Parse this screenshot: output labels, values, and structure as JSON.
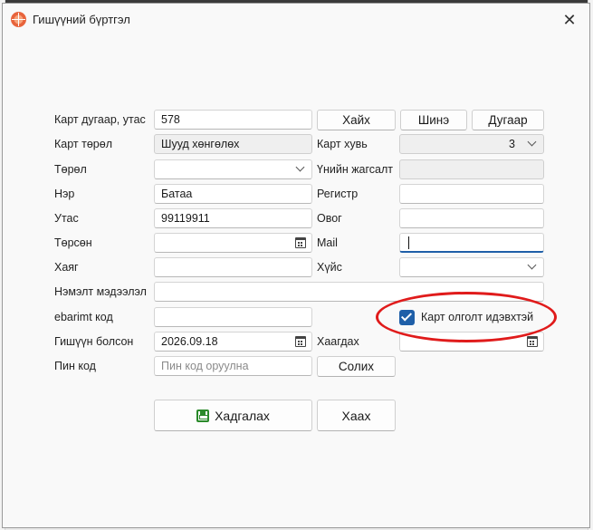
{
  "window": {
    "title": "Гишүүний бүртгэл",
    "close_glyph": "✕"
  },
  "labels": {
    "card_number_phone": "Карт дугаар, утас",
    "card_type": "Карт төрөл",
    "type": "Төрөл",
    "name": "Нэр",
    "phone": "Утас",
    "birth": "Төрсөн",
    "address": "Хаяг",
    "extra_info": "Нэмэлт мэдээлэл",
    "ebarimt": "ebarimt код",
    "member_since": "Гишүүн болсон",
    "pin": "Пин код",
    "card_share": "Карт хувь",
    "price_list": "Үнийн жагсалт",
    "register": "Регистр",
    "surname": "Овог",
    "mail": "Mail",
    "gender": "Хүйс",
    "close_date": "Хаагдах"
  },
  "fields": {
    "card_number": "578",
    "card_type": "Шууд хөнгөлөх",
    "type": "",
    "name": "Батаа",
    "phone": "99119911",
    "birth": "",
    "address": "",
    "extra_info": "",
    "ebarimt": "",
    "member_since": "2026.09.18",
    "pin_placeholder": "Пин код оруулна",
    "card_share": "3",
    "price_list": "",
    "register": "",
    "surname": "",
    "mail": "",
    "gender": "",
    "close_date": ""
  },
  "buttons": {
    "search": "Хайх",
    "new": "Шинэ",
    "number": "Дугаар",
    "change": "Солих",
    "save": "Хадгалах",
    "close": "Хаах"
  },
  "checkbox": {
    "label": "Карт олголт идэвхтэй",
    "checked": true
  },
  "colors": {
    "accent": "#1f5fa8",
    "annotation": "#e01b1b",
    "save_icon": "#2a8a2a"
  }
}
